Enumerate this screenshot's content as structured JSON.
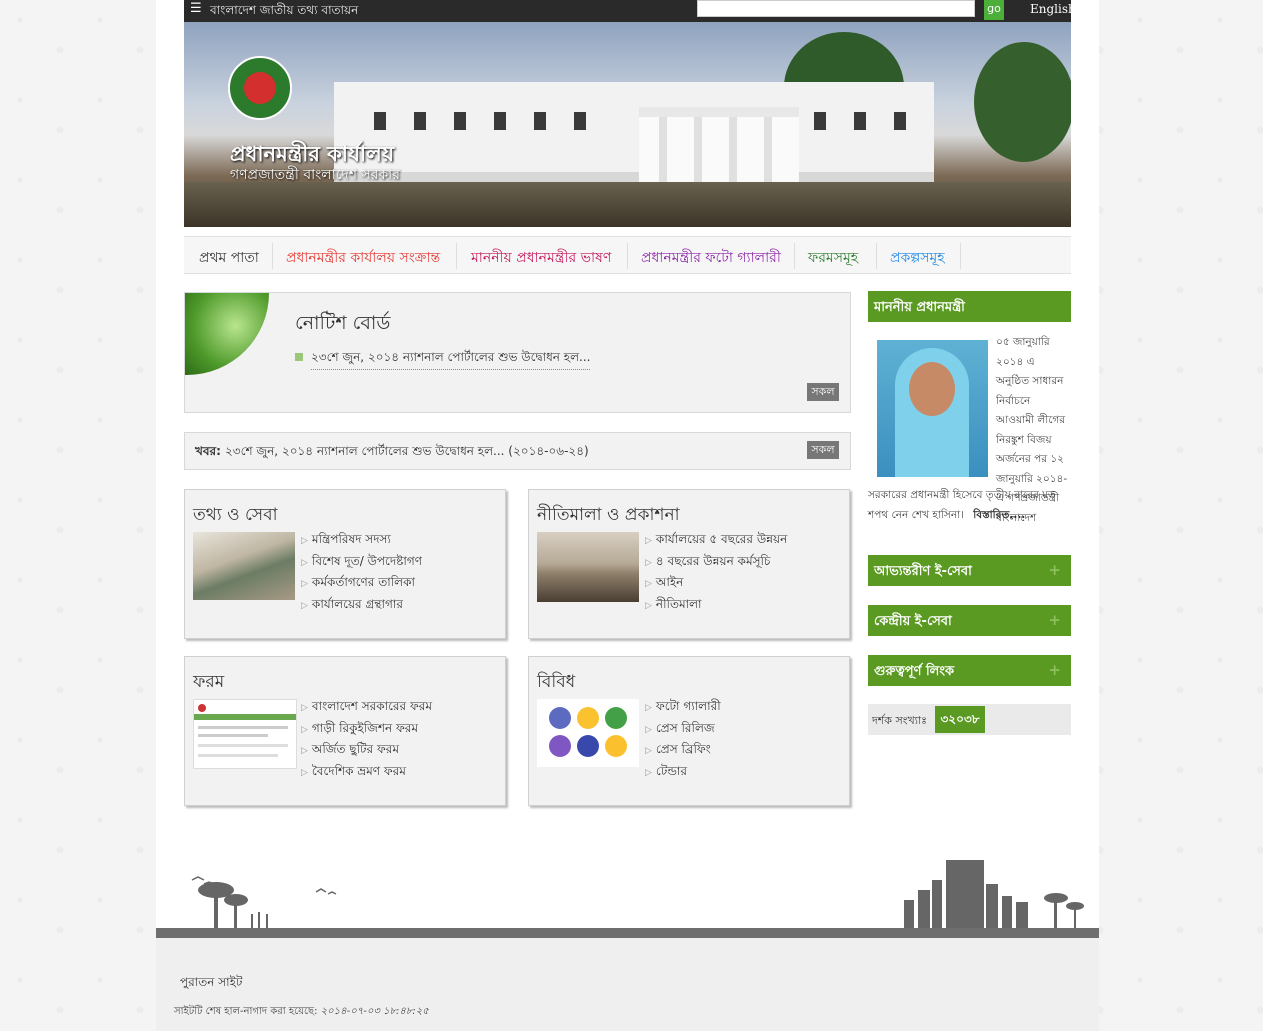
{
  "topbar": {
    "portal_name": "বাংলাদেশ জাতীয় তথ্য বাতায়ন",
    "search_value": "",
    "go_label": "go",
    "language_label": "English"
  },
  "banner": {
    "title": "প্রধানমন্ত্রীর কার্যালয়",
    "subtitle": "গণপ্রজাতন্ত্রী বাংলাদেশ সরকার"
  },
  "nav": {
    "items": [
      {
        "label": "প্রথম পাতা",
        "color": "#333333"
      },
      {
        "label": "প্রধানমন্ত্রীর কার্যালয় সংক্রান্ত",
        "color": "#e53935"
      },
      {
        "label": "মাননীয় প্রধানমন্ত্রীর ভাষণ",
        "color": "#c2185b"
      },
      {
        "label": "প্রধানমন্ত্রীর ফটো গ্যালারী",
        "color": "#8e24aa"
      },
      {
        "label": "ফরমসমূহ",
        "color": "#2e7d32"
      },
      {
        "label": "প্রকল্পসমূহ",
        "color": "#1e88e5"
      }
    ]
  },
  "notice": {
    "heading": "নোটিশ বোর্ড",
    "item": "২৩শে জুন, ২০১৪ ন্যাশনাল পোর্টালের শুভ উদ্বোধন হল...",
    "all_label": "সকল"
  },
  "news": {
    "label": "খবর:",
    "text": "২৩শে জুন, ২০১৪ ন্যাশনাল পোর্টালের শুভ উদ্বোধন হল... (২০১৪-০৬-২৪)",
    "all_label": "সকল"
  },
  "boxes": {
    "info": {
      "title": "তথ্য ও সেবা",
      "links": [
        "মন্ত্রিপরিষদ সদস্য",
        "বিশেষ দূত/ উপদেষ্টাগণ",
        "কর্মকর্তাগণের তালিকা",
        "কার্যালয়ের গ্রন্থাগার"
      ]
    },
    "policy": {
      "title": "নীতিমালা ও প্রকাশনা",
      "links": [
        "কার্যালয়ের ৫ বছরের উন্নয়ন",
        "৪ বছরের উন্নয়ন কর্মসূচি",
        "আইন",
        "নীতিমালা"
      ]
    },
    "forms": {
      "title": "ফরম",
      "links": [
        "বাংলাদেশ সরকারের ফরম",
        "গাড়ী রিকুইজিশন ফরম",
        "অর্জিত ছুটির ফরম",
        "বৈদেশিক ভ্রমণ ফরম"
      ]
    },
    "misc": {
      "title": "বিবিধ",
      "links": [
        "ফটো গ্যালারী",
        "প্রেস রিলিজ",
        "প্রেস ব্রিফিং",
        "টেন্ডার"
      ]
    }
  },
  "sidebar": {
    "pm_heading": "মাননীয় প্রধানমন্ত্রী",
    "pm_text_side": "০৫ জানুয়ারি ২০১৪ এ অনুষ্ঠিত সাধারন নির্বাচনে আওয়ামী লীগের নিরঙ্কুশ বিজয় অর্জনের পর ১২ জানুয়ারি ২০১৪-এ গণপ্রজাতন্ত্রী বাংলাদেশ",
    "pm_text_bottom": "সরকারের প্রধানমন্ত্রী হিসেবে তৃতীয় বারের মত শপথ নেন শেখ হাসিনা।",
    "details_label": "বিস্তারিত....",
    "sections": [
      "আভ্যন্তরীণ ই-সেবা",
      "কেন্দ্রীয় ই-সেবা",
      "গুরুত্বপূর্ণ লিংক"
    ],
    "visitor_label": "দর্শক সংখ্যাঃ",
    "visitor_count": "৩২০৩৮"
  },
  "footer": {
    "old_site": "পুরাতন সাইট",
    "updated_label": "সাইটটি শেষ হাল-নাগাদ করা হয়েছে:",
    "updated_value": "২০১৪-০৭-০৩ ১৮:৪৮:২৫"
  },
  "colors": {
    "accent_green": "#5b9a22",
    "topbar": "#2a2a2a"
  }
}
